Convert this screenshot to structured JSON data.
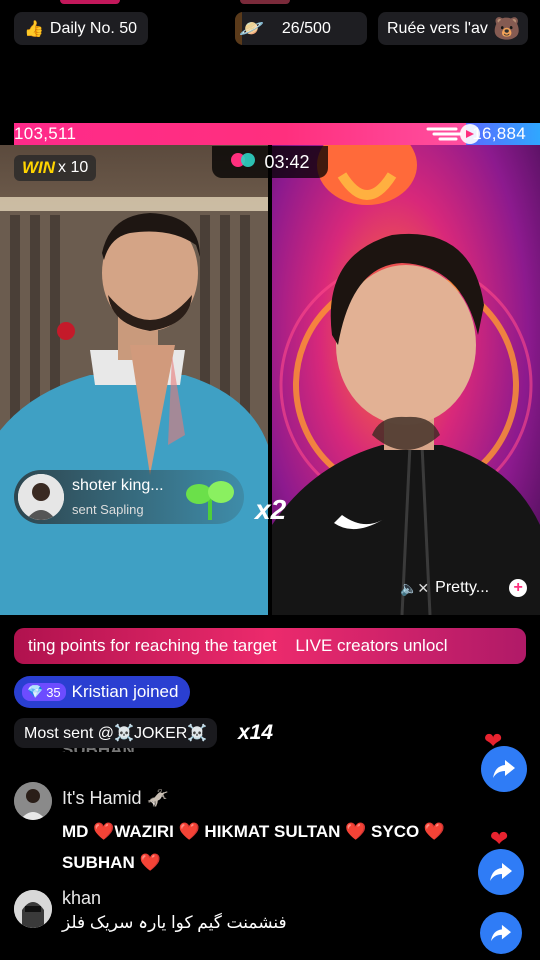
{
  "top_bar": {
    "daily_label": "Daily No. 50",
    "progress_text": "26/500",
    "progress_value": 0.052,
    "ruee_label": "Ruée vers l'av"
  },
  "battle": {
    "score_left": "103,511",
    "score_right": "16,884",
    "score_left_fraction": 0.86,
    "timer": "03:42",
    "win_label": "WIN",
    "win_count": "x 10",
    "multiplier": "x2"
  },
  "gift_toast": {
    "user": "shoter king...",
    "action": "sent Sapling"
  },
  "right_stream": {
    "name": "Pretty..."
  },
  "ticker_text": "ting points for reaching the target    LIVE creators unlocl",
  "joined": {
    "level": "35",
    "text": "Kristian joined"
  },
  "most_sent": {
    "text": "Most sent @☠️JOKER☠️",
    "count": "x14"
  },
  "comments": [
    {
      "partial": "SUBHAN",
      "name": "It's Hamid 🫏",
      "line1": "MD ❤️WAZIRI ❤️ HIKMAT SULTAN ❤️ SYCO ❤️",
      "line2": "SUBHAN ❤️"
    },
    {
      "name": "khan",
      "text": "فنشمنت گیم کوا یارہ سریک فلز"
    }
  ],
  "colors": {
    "pink": "#ff2f7e",
    "blue": "#2f7cf6",
    "win_yellow": "#ffd400"
  }
}
